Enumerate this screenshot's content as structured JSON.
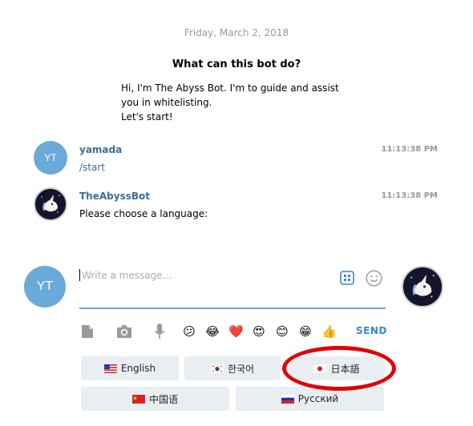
{
  "date_separator": "Friday, March 2, 2018",
  "intro": {
    "title": "What can this bot do?",
    "lines": [
      "Hi, I'm The Abyss Bot. I'm to guide and assist",
      "you in whitelisting.",
      "Let's start!"
    ]
  },
  "messages": [
    {
      "avatar_text": "YT",
      "name": "yamada",
      "text": "/start",
      "time": "11:13:38 PM"
    },
    {
      "name": "TheAbyssBot",
      "text": "Please choose a language:",
      "time": "11:13:38 PM"
    }
  ],
  "composer": {
    "avatar_text": "YT",
    "placeholder": "Write a message...",
    "send_label": "SEND"
  },
  "languages": [
    {
      "label": "English",
      "flag": "us"
    },
    {
      "label": "한국어",
      "flag": "kr"
    },
    {
      "label": "日本語",
      "flag": "jp"
    },
    {
      "label": "中国语",
      "flag": "cn"
    },
    {
      "label": "Русский",
      "flag": "ru"
    }
  ],
  "emojis": [
    "confused-face",
    "tears-of-joy-face",
    "red-heart",
    "heart-eyes-face",
    "smiling-face",
    "grinning-face",
    "thumbs-up"
  ],
  "colors": {
    "accent": "#3a86c8",
    "name": "#3a6d99",
    "avatar": "#6aaad8",
    "lang_button": "#e9eef2",
    "highlight_ellipse": "#e00000"
  }
}
